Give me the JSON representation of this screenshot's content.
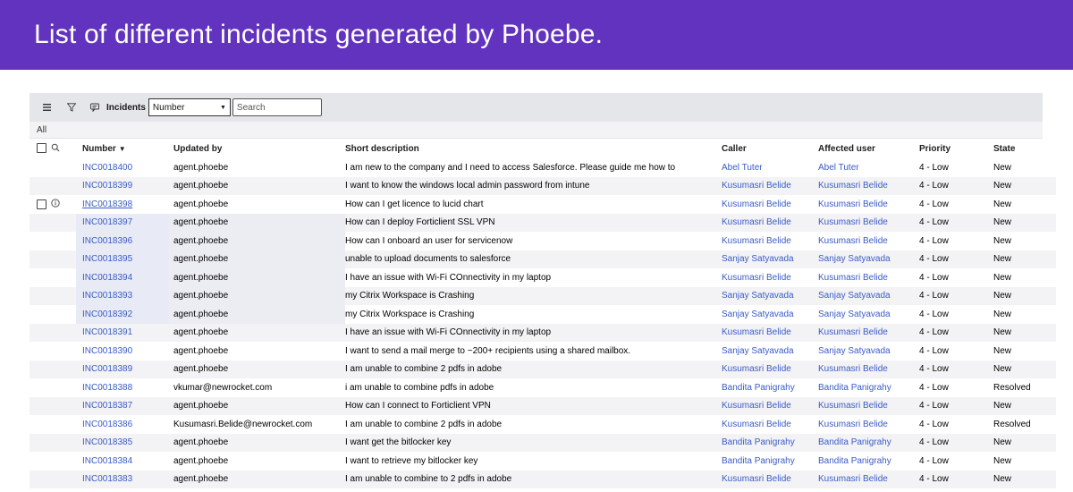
{
  "banner": {
    "title": "List of different incidents generated by Phoebe."
  },
  "toolbar": {
    "title": "Incidents",
    "select_value": "Number",
    "search_placeholder": "Search"
  },
  "breadcrumb": "All",
  "columns": {
    "number": "Number",
    "updated_by": "Updated by",
    "short_description": "Short description",
    "caller": "Caller",
    "affected_user": "Affected user",
    "priority": "Priority",
    "state": "State"
  },
  "rows": [
    {
      "number": "INC0018400",
      "updated_by": "agent.phoebe",
      "short_description": "I am new to the company and I need to access Salesforce. Please guide me how to",
      "caller": "Abel Tuter",
      "affected_user": "Abel Tuter",
      "priority": "4 - Low",
      "state": "New"
    },
    {
      "number": "INC0018399",
      "updated_by": "agent.phoebe",
      "short_description": "I want to know the windows local admin password from intune",
      "caller": "Kusumasri Belide",
      "affected_user": "Kusumasri Belide",
      "priority": "4 - Low",
      "state": "New"
    },
    {
      "number": "INC0018398",
      "updated_by": "agent.phoebe",
      "short_description": "How can I get licence to lucid chart",
      "caller": "Kusumasri Belide",
      "affected_user": "Kusumasri Belide",
      "priority": "4 - Low",
      "state": "New"
    },
    {
      "number": "INC0018397",
      "updated_by": "agent.phoebe",
      "short_description": "How can I deploy Forticlient SSL VPN",
      "caller": "Kusumasri Belide",
      "affected_user": "Kusumasri Belide",
      "priority": "4 - Low",
      "state": "New"
    },
    {
      "number": "INC0018396",
      "updated_by": "agent.phoebe",
      "short_description": "How can I onboard an user for servicenow",
      "caller": "Kusumasri Belide",
      "affected_user": "Kusumasri Belide",
      "priority": "4 - Low",
      "state": "New"
    },
    {
      "number": "INC0018395",
      "updated_by": "agent.phoebe",
      "short_description": "unable to upload documents to salesforce",
      "caller": "Sanjay Satyavada",
      "affected_user": "Sanjay Satyavada",
      "priority": "4 - Low",
      "state": "New"
    },
    {
      "number": "INC0018394",
      "updated_by": "agent.phoebe",
      "short_description": "I have an issue with Wi-Fi COnnectivity in my laptop",
      "caller": "Kusumasri Belide",
      "affected_user": "Kusumasri Belide",
      "priority": "4 - Low",
      "state": "New"
    },
    {
      "number": "INC0018393",
      "updated_by": "agent.phoebe",
      "short_description": "my Citrix Workspace is Crashing",
      "caller": "Sanjay Satyavada",
      "affected_user": "Sanjay Satyavada",
      "priority": "4 - Low",
      "state": "New"
    },
    {
      "number": "INC0018392",
      "updated_by": "agent.phoebe",
      "short_description": "my Citrix Workspace is Crashing",
      "caller": "Sanjay Satyavada",
      "affected_user": "Sanjay Satyavada",
      "priority": "4 - Low",
      "state": "New"
    },
    {
      "number": "INC0018391",
      "updated_by": "agent.phoebe",
      "short_description": "I have an issue with Wi-Fi COnnectivity in my laptop",
      "caller": "Kusumasri Belide",
      "affected_user": "Kusumasri Belide",
      "priority": "4 - Low",
      "state": "New"
    },
    {
      "number": "INC0018390",
      "updated_by": "agent.phoebe",
      "short_description": "I want to send a mail merge to ~200+ recipients using a shared mailbox.",
      "caller": "Sanjay Satyavada",
      "affected_user": "Sanjay Satyavada",
      "priority": "4 - Low",
      "state": "New"
    },
    {
      "number": "INC0018389",
      "updated_by": "agent.phoebe",
      "short_description": "I am unable to combine 2 pdfs in adobe",
      "caller": "Kusumasri Belide",
      "affected_user": "Kusumasri Belide",
      "priority": "4 - Low",
      "state": "New"
    },
    {
      "number": "INC0018388",
      "updated_by": "vkumar@newrocket.com",
      "short_description": "i am unable to combine pdfs in adobe",
      "caller": "Bandita Panigrahy",
      "affected_user": "Bandita Panigrahy",
      "priority": "4 - Low",
      "state": "Resolved"
    },
    {
      "number": "INC0018387",
      "updated_by": "agent.phoebe",
      "short_description": "How can I connect to Forticlient VPN",
      "caller": "Kusumasri Belide",
      "affected_user": "Kusumasri Belide",
      "priority": "4 - Low",
      "state": "New"
    },
    {
      "number": "INC0018386",
      "updated_by": "Kusumasri.Belide@newrocket.com",
      "short_description": "I am unable to combine 2 pdfs in adobe",
      "caller": "Kusumasri Belide",
      "affected_user": "Kusumasri Belide",
      "priority": "4 - Low",
      "state": "Resolved"
    },
    {
      "number": "INC0018385",
      "updated_by": "agent.phoebe",
      "short_description": "I want get the bitlocker key",
      "caller": "Bandita Panigrahy",
      "affected_user": "Bandita Panigrahy",
      "priority": "4 - Low",
      "state": "New"
    },
    {
      "number": "INC0018384",
      "updated_by": "agent.phoebe",
      "short_description": "I want to retrieve my bitlocker key",
      "caller": "Bandita Panigrahy",
      "affected_user": "Bandita Panigrahy",
      "priority": "4 - Low",
      "state": "New"
    },
    {
      "number": "INC0018383",
      "updated_by": "agent.phoebe",
      "short_description": "I am unable to combine to 2 pdfs in adobe",
      "caller": "Kusumasri Belide",
      "affected_user": "Kusumasri Belide",
      "priority": "4 - Low",
      "state": "New"
    }
  ],
  "hovered_row_index": 2,
  "highlighted_row_indices": [
    3,
    4,
    5,
    6,
    7,
    8
  ],
  "icons": {
    "menu": "hamburger-menu-icon",
    "filter": "filter-funnel-icon",
    "chat": "chat-bubble-icon",
    "search": "search-icon",
    "info": "info-circle-icon"
  },
  "colors": {
    "banner": "#6233bf",
    "link": "#3a5bc7",
    "toolbar_bg": "#e5e6ea"
  }
}
